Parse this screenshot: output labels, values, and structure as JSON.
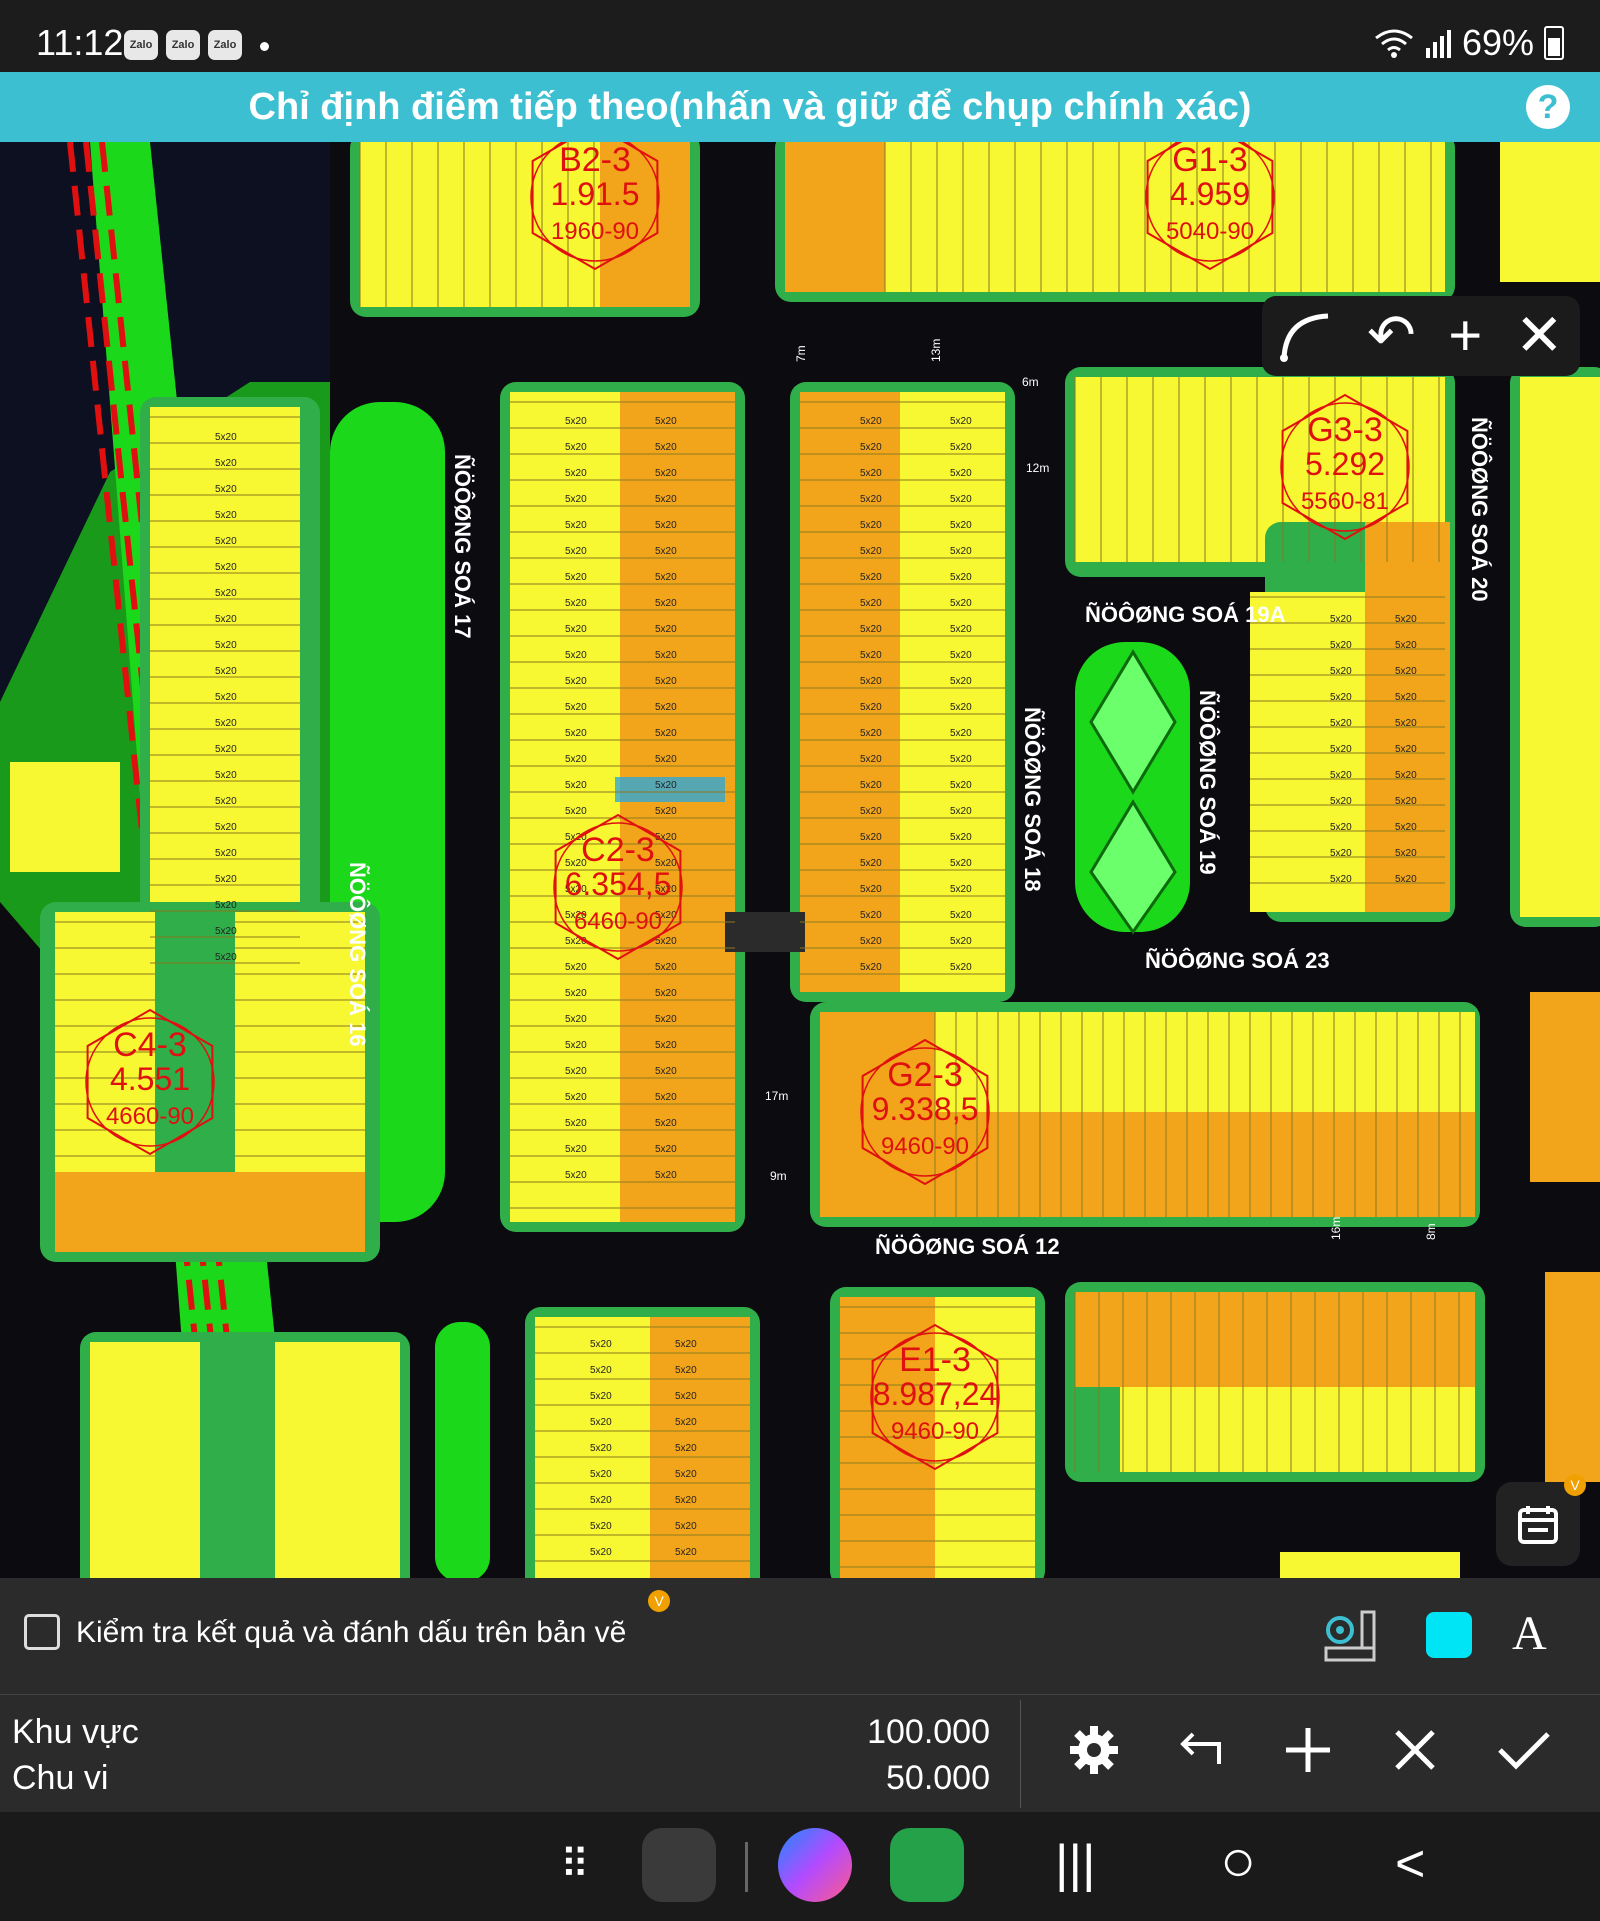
{
  "status_bar": {
    "time": "11:12",
    "notification_apps": [
      "Zalo",
      "Zalo",
      "Zalo"
    ],
    "battery": "69%"
  },
  "header": {
    "title": "Chỉ định điểm tiếp theo(nhấn và giữ để chụp chính xác)",
    "help_label": "?"
  },
  "map": {
    "street_labels": [
      "ÑÖÔØNG SOÁ 17",
      "ÑÖÔØNG SOÁ 16",
      "ÑÖÔØNG SOÁ 18",
      "ÑÖÔØNG SOÁ 19",
      "ÑÖÔØNG SOÁ 19A",
      "ÑÖÔØNG SOÁ 20",
      "ÑÖÔØNG SOÁ 23",
      "ÑÖÔØNG SOÁ 12"
    ],
    "blocks": [
      {
        "name": "B2-3",
        "area": "1.91.5",
        "code": "1960-90"
      },
      {
        "name": "G1-3",
        "area": "4.959",
        "code": "5040-90"
      },
      {
        "name": "G3-3",
        "area": "5.292",
        "code": "5560-81"
      },
      {
        "name": "C2-3",
        "area": "6.354,5",
        "code": "6460-90"
      },
      {
        "name": "C4-3",
        "area": "4.551",
        "code": "4660-90"
      },
      {
        "name": "G2-3",
        "area": "9.338,5",
        "code": "9460-90"
      },
      {
        "name": "E1-3",
        "area": "8.987,24",
        "code": "9460-90"
      }
    ],
    "lot_label": "5x20",
    "road_widths": [
      "7m",
      "13m",
      "6m",
      "12m",
      "17m",
      "9m",
      "8m",
      "16m"
    ],
    "tools": {
      "arc": "arc-tool",
      "undo": "↶",
      "add": "+",
      "close": "✕"
    },
    "calendar_badge": "V"
  },
  "panel": {
    "check_label": "Kiểm tra kết quả và đánh dấu trên bản vẽ",
    "check_badge": "V",
    "swatch_color": "#00e5f5",
    "font_tool": "A",
    "area_label": "Khu vực",
    "area_value": "100.000",
    "perimeter_label": "Chu vi",
    "perimeter_value": "50.000"
  },
  "nav": {
    "apps_grid": "⠿",
    "recents": "|||",
    "home": "○",
    "back": "<"
  }
}
